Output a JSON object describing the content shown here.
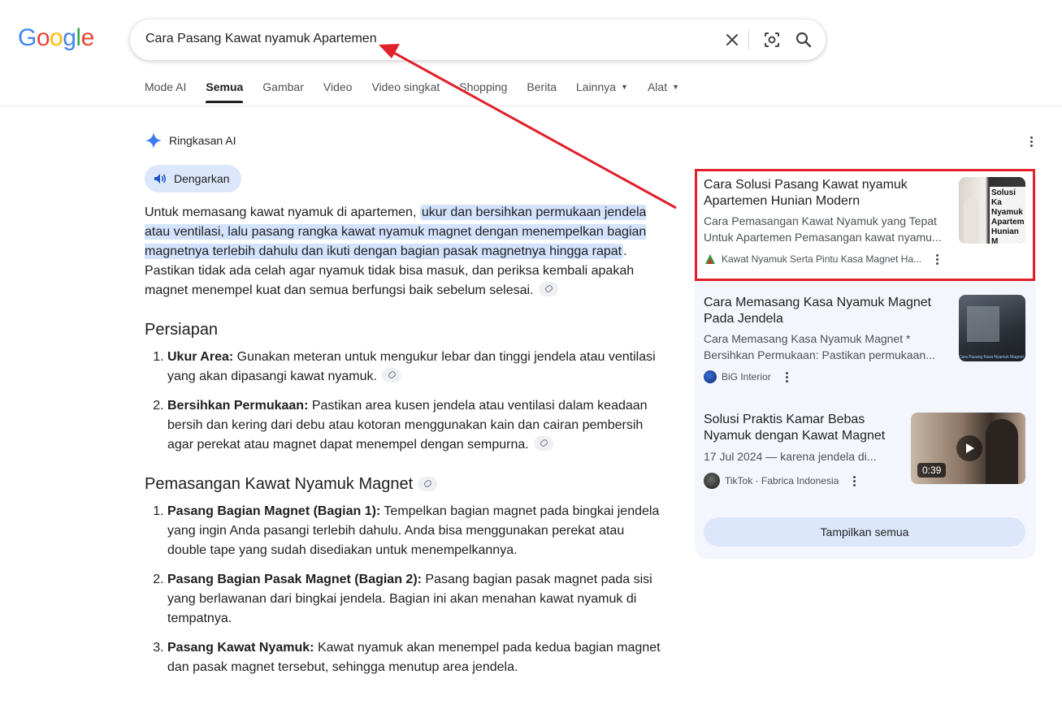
{
  "logo": {
    "text": "Google",
    "letters": [
      "G",
      "o",
      "o",
      "g",
      "l",
      "e"
    ],
    "colors": [
      "#4285F4",
      "#EA4335",
      "#FBBC05",
      "#4285F4",
      "#34A853",
      "#EA4335"
    ]
  },
  "search": {
    "query": "Cara Pasang Kawat nyamuk Apartemen",
    "icons": [
      "close-icon",
      "lens-icon",
      "search-icon"
    ]
  },
  "tabs": [
    {
      "label": "Mode AI",
      "active": false
    },
    {
      "label": "Semua",
      "active": true
    },
    {
      "label": "Gambar",
      "active": false
    },
    {
      "label": "Video",
      "active": false
    },
    {
      "label": "Video singkat",
      "active": false
    },
    {
      "label": "Shopping",
      "active": false
    },
    {
      "label": "Berita",
      "active": false
    },
    {
      "label": "Lainnya",
      "active": false,
      "dropdown": true
    },
    {
      "label": "Alat",
      "active": false,
      "dropdown": true
    }
  ],
  "ai_overview": {
    "title": "Ringkasan AI",
    "listen_label": "Dengarkan",
    "intro_plain": "Untuk memasang kawat nyamuk di apartemen, ",
    "intro_highlight": "ukur dan bersihkan permukaan jendela atau ventilasi, lalu pasang rangka kawat nyamuk magnet dengan menempelkan bagian magnetnya terlebih dahulu dan ikuti dengan bagian pasak magnetnya hingga rapat",
    "intro_rest": ". Pastikan tidak ada celah agar nyamuk tidak bisa masuk, dan periksa kembali apakah magnet menempel kuat dan semua berfungsi baik sebelum selesai.",
    "section1_title": "Persiapan",
    "section1_items": [
      {
        "bold": "Ukur Area:",
        "text": " Gunakan meteran untuk mengukur lebar dan tinggi jendela atau ventilasi yang akan dipasangi kawat nyamuk."
      },
      {
        "bold": "Bersihkan Permukaan:",
        "text": " Pastikan area kusen jendela atau ventilasi dalam keadaan bersih dan kering dari debu atau kotoran menggunakan kain dan cairan pembersih agar perekat atau magnet dapat menempel dengan sempurna."
      }
    ],
    "section2_title": "Pemasangan Kawat Nyamuk Magnet",
    "section2_items": [
      {
        "bold": "Pasang Bagian Magnet (Bagian 1):",
        "text": " Tempelkan bagian magnet pada bingkai jendela yang ingin Anda pasangi terlebih dahulu. Anda bisa menggunakan perekat atau double tape yang sudah disediakan untuk menempelkannya."
      },
      {
        "bold": "Pasang Bagian Pasak Magnet (Bagian 2):",
        "text": " Pasang bagian pasak magnet pada sisi yang berlawanan dari bingkai jendela. Bagian ini akan menahan kawat nyamuk di tempatnya."
      },
      {
        "bold": "Pasang Kawat Nyamuk:",
        "text": " Kawat nyamuk akan menempel pada kedua bagian magnet dan pasak magnet tersebut, sehingga menutup area jendela."
      }
    ]
  },
  "sources": [
    {
      "title": "Cara Solusi Pasang Kawat nyamuk Apartemen Hunian Modern",
      "snippet1": "Cara Pemasangan Kawat Nyamuk yang Tepat",
      "snippet2": "Untuk Apartemen Pemasangan kawat nyamu...",
      "source": "Kawat Nyamuk Serta Pintu Kasa Magnet Ha...",
      "thumb_text": "Solusi Ka Nyamuk Apartem Hunian M",
      "highlighted": true
    },
    {
      "title": "Cara Memasang Kasa Nyamuk Magnet Pada Jendela",
      "snippet1": "Cara Memasang Kasa Nyamuk Magnet *",
      "snippet2": "Bersihkan Permukaan: Pastikan permukaan...",
      "source": "BiG Interior",
      "thumb_text": "Cara Pasang Kasa Nyamuk Magnet Jendela"
    },
    {
      "title": "Solusi Praktis Kamar Bebas Nyamuk dengan Kawat Magnet",
      "snippet1": "17 Jul 2024 — karena jendela di...",
      "source": "TikTok · Fabrica Indonesia",
      "duration": "0:39"
    }
  ],
  "show_all_label": "Tampilkan semua",
  "annotation_color": "#e0202a"
}
